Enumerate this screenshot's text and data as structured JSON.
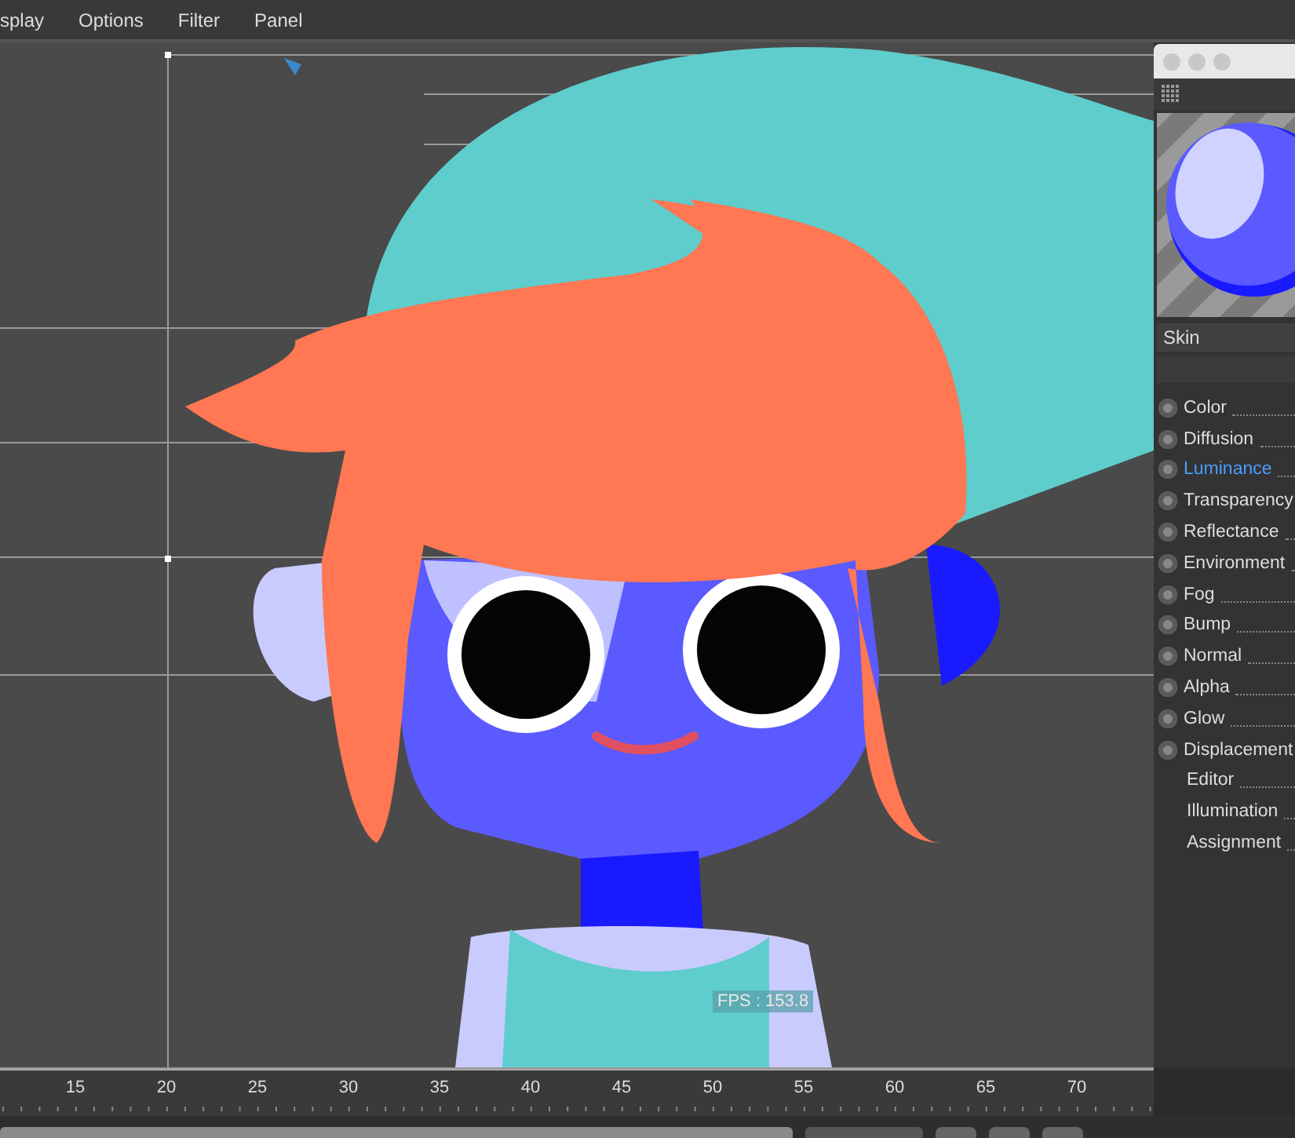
{
  "menu": [
    "splay",
    "Options",
    "Filter",
    "Panel"
  ],
  "viewport": {
    "fps": "FPS : 153.8"
  },
  "material": {
    "name": "Skin",
    "channels": [
      {
        "label": "Color",
        "kind": "channel",
        "selected": false
      },
      {
        "label": "Diffusion",
        "kind": "channel",
        "selected": false
      },
      {
        "label": "Luminance",
        "kind": "channel",
        "selected": true
      },
      {
        "label": "Transparency",
        "kind": "channel",
        "selected": false
      },
      {
        "label": "Reflectance",
        "kind": "channel",
        "selected": false
      },
      {
        "label": "Environment",
        "kind": "channel",
        "selected": false
      },
      {
        "label": "Fog",
        "kind": "channel",
        "selected": false
      },
      {
        "label": "Bump",
        "kind": "channel",
        "selected": false
      },
      {
        "label": "Normal",
        "kind": "channel",
        "selected": false
      },
      {
        "label": "Alpha",
        "kind": "channel",
        "selected": false
      },
      {
        "label": "Glow",
        "kind": "channel",
        "selected": false
      },
      {
        "label": "Displacement",
        "kind": "channel",
        "selected": false
      },
      {
        "label": "Editor",
        "kind": "plain",
        "selected": false
      },
      {
        "label": "Illumination",
        "kind": "plain",
        "selected": false
      },
      {
        "label": "Assignment",
        "kind": "plain",
        "selected": false
      }
    ]
  },
  "timeline": {
    "range": {
      "level": 1
    },
    "ticks": [
      "15",
      "20",
      "25",
      "30",
      "35",
      "40",
      "45",
      "50",
      "55",
      "60",
      "65",
      "70"
    ]
  }
}
